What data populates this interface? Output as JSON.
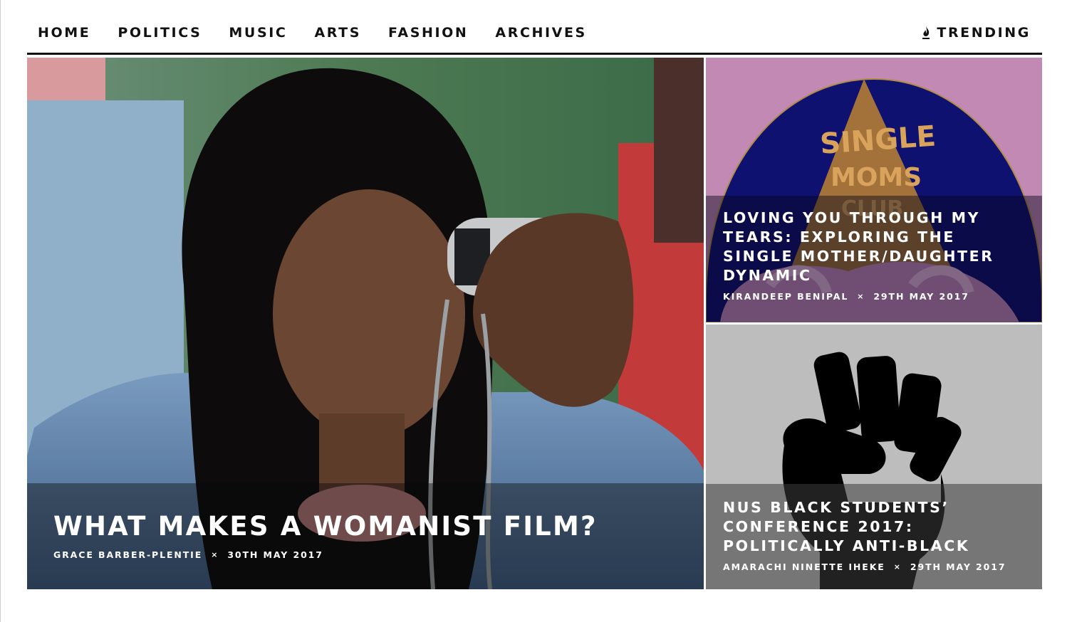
{
  "nav": {
    "items": [
      {
        "label": "HOME"
      },
      {
        "label": "POLITICS"
      },
      {
        "label": "MUSIC"
      },
      {
        "label": "ARTS"
      },
      {
        "label": "FASHION"
      },
      {
        "label": "ARCHIVES"
      }
    ],
    "trending_label": "TRENDING",
    "trending_icon": "flame-icon"
  },
  "articles": {
    "main": {
      "title": "WHAT MAKES A WOMANIST FILM?",
      "author": "GRACE BARBER-PLENTIE",
      "separator": "×",
      "date": "30TH MAY 2017"
    },
    "top": {
      "title": "LOVING YOU THROUGH MY TEARS: EXPLORING THE SINGLE MOTHER/DAUGHTER DYNAMIC",
      "author": "KIRANDEEP BENIPAL",
      "separator": "×",
      "date": "29TH MAY 2017"
    },
    "bottom": {
      "title": "NUS BLACK STUDENTS’ CONFERENCE 2017: POLITICALLY ANTI-BLACK",
      "author": "AMARACHI NINETTE IHEKE",
      "separator": "×",
      "date": "29TH MAY 2017"
    }
  },
  "colors": {
    "text": "#111111",
    "overlay_text": "#ffffff",
    "top_card_bg": "#c189b4",
    "top_card_circle": "#0f1170",
    "top_card_lettering": "#d9a35c",
    "bottom_card_bg": "#bdbdbd",
    "fist": "#000000"
  }
}
